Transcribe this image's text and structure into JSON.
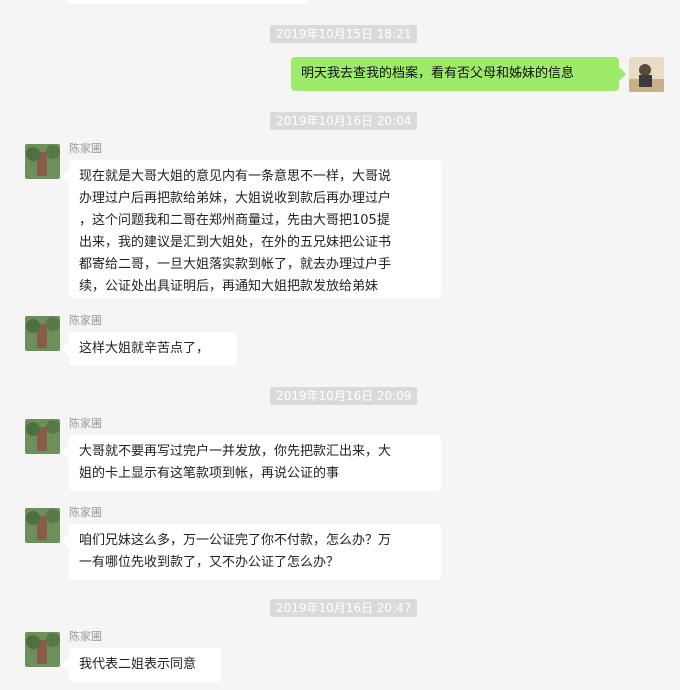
{
  "messages": [
    {
      "type": "time",
      "text": "2019年10月15日 18:21"
    },
    {
      "type": "me",
      "text": "明天我去查我的档案，看有否父母和姊妹的信息"
    },
    {
      "type": "time",
      "text": "2019年10月16日 20:04"
    },
    {
      "type": "other",
      "name": "陈家圃",
      "lines": [
        "现在就是大哥大姐的意见内有一条意思不一样，大哥说",
        "办理过户后再把款给弟妹，大姐说收到款后再办理过户",
        "，这个问题我和二哥在郑州商量过，先由大哥把105提",
        "出来，我的建议是汇到大姐处，在外的五兄妹把公证书",
        "都寄给二哥，一旦大姐落实款到帐了，就去办理过户手",
        "续，公证处出具证明后，再通知大姐把款发放给弟妹"
      ]
    },
    {
      "type": "other",
      "name": "陈家圃",
      "lines": [
        "这样大姐就辛苦点了，"
      ]
    },
    {
      "type": "time",
      "text": "2019年10月16日 20:09"
    },
    {
      "type": "other",
      "name": "陈家圃",
      "lines": [
        "大哥就不要再写过完户一并发放，你先把款汇出来，大",
        "姐的卡上显示有这笔款项到帐，再说公证的事"
      ]
    },
    {
      "type": "other",
      "name": "陈家圃",
      "lines": [
        "咱们兄妹这么多，万一公证完了你不付款，怎么办？万",
        "一有哪位先收到款了，又不办公证了怎么办？"
      ]
    },
    {
      "type": "time",
      "text": "2019年10月16日 20:47"
    },
    {
      "type": "other",
      "name": "陈家圃",
      "lines": [
        "我代表二姐表示同意"
      ]
    }
  ]
}
